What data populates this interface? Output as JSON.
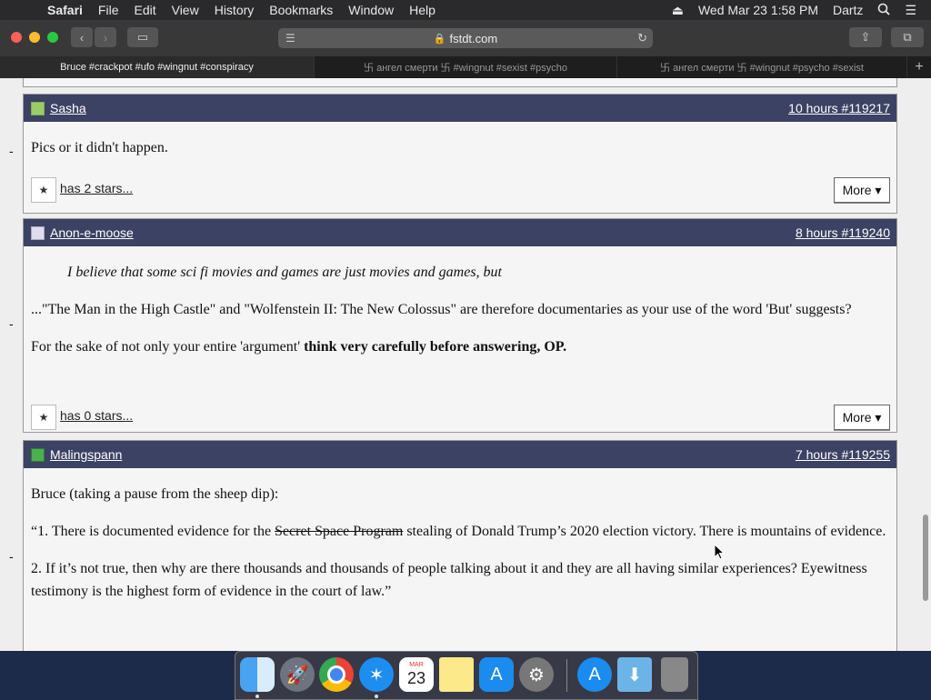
{
  "menubar": {
    "apple": "",
    "items": [
      "Safari",
      "File",
      "Edit",
      "View",
      "History",
      "Bookmarks",
      "Window",
      "Help"
    ],
    "clock": "Wed Mar 23  1:58 PM",
    "user": "Dartz"
  },
  "toolbar": {
    "url": "fstdt.com"
  },
  "tabs": [
    {
      "label": "Bruce #crackpot #ufo #wingnut #conspiracy"
    },
    {
      "label": "卐 ангел смерти 卐 #wingnut #sexist #psycho"
    },
    {
      "label": "卐 ангел смерти 卐 #wingnut #psycho #sexist"
    }
  ],
  "posts": [
    {
      "author": "Sasha",
      "meta": "10 hours #119217",
      "paragraphs": [
        "Pics or it didn't happen."
      ],
      "stars": "has 2 stars...",
      "more": "More ▾"
    },
    {
      "author": "Anon-e-moose",
      "meta": "8 hours #119240",
      "quote": "I believe that some sci fi movies and games are just movies and games, but",
      "p1": "...\"The Man in the High Castle\" and \"Wolfenstein II: The New Colossus\" are therefore documentaries as your use of the word 'But' suggests?",
      "p2_plain": "For the sake of not only your entire 'argument' ",
      "p2_bold": "think very carefully before answering, OP.",
      "stars": "has 0 stars...",
      "more": "More ▾"
    },
    {
      "author": "Malingspann",
      "meta": "7 hours #119255",
      "p1": "Bruce (taking a pause from the sheep dip):",
      "p2_a": "“1. There is documented evidence for the ",
      "p2_strike": "Secret Space Program",
      "p2_b": " stealing of Donald Trump’s 2020 election victory. There is mountains of evidence.",
      "p3": "2. If it’s not true, then why are there thousands and thousands of people talking about it and they are all having similar experiences? Eyewitness testimony is the highest form of evidence in the court of law.”"
    }
  ],
  "dash": "-",
  "dock": {
    "icons": [
      "finder-icon",
      "launchpad-icon",
      "chrome-icon",
      "safari-icon",
      "calendar-icon",
      "notes-icon",
      "app-store-icon",
      "system-preferences-icon",
      "app-store-icon",
      "downloads-folder-icon",
      "trash-icon"
    ],
    "calendar_month": "MAR",
    "calendar_day": "23"
  }
}
